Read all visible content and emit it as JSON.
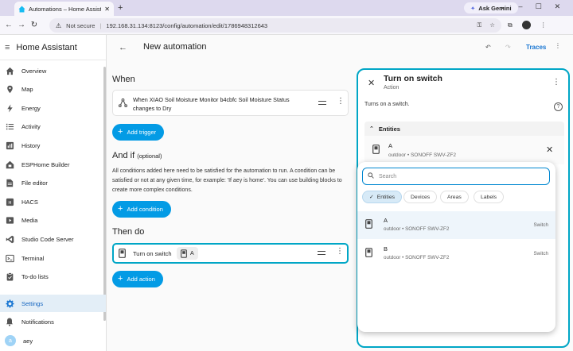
{
  "browser": {
    "tab_title": "Automations – Home Assistant",
    "new_tab": "+",
    "gemini_label": "Ask Gemini",
    "not_secure": "Not secure",
    "url": "192.168.31.134:8123/config/automation/edit/1786948312643"
  },
  "sidebar": {
    "title": "Home Assistant",
    "items": [
      {
        "label": "Overview",
        "icon": "home-icon"
      },
      {
        "label": "Map",
        "icon": "map-icon"
      },
      {
        "label": "Energy",
        "icon": "lightning-icon"
      },
      {
        "label": "Activity",
        "icon": "list-icon"
      },
      {
        "label": "History",
        "icon": "chart-icon"
      },
      {
        "label": "ESPHome Builder",
        "icon": "esphome-icon"
      },
      {
        "label": "File editor",
        "icon": "wrench-icon"
      },
      {
        "label": "HACS",
        "icon": "hacs-icon"
      },
      {
        "label": "Media",
        "icon": "media-icon"
      },
      {
        "label": "Studio Code Server",
        "icon": "vscode-icon"
      },
      {
        "label": "Terminal",
        "icon": "terminal-icon"
      },
      {
        "label": "To-do lists",
        "icon": "clipboard-icon"
      }
    ],
    "settings": "Settings",
    "notifications": "Notifications",
    "user_initial": "a",
    "user_name": "aey"
  },
  "header": {
    "title": "New automation",
    "traces": "Traces"
  },
  "when": {
    "heading": "When",
    "trigger_text": "When XIAO Soil Moisture Monitor b4cbfc Soil Moisture Status changes to Dry",
    "add_trigger": "Add trigger"
  },
  "and_if": {
    "heading": "And if",
    "optional": "(optional)",
    "description": "All conditions added here need to be satisfied for the automation to run. A condition can be satisfied or not at any given time, for example: 'If aey is home'. You can use building blocks to create more complex conditions.",
    "add_condition": "Add condition"
  },
  "then_do": {
    "heading": "Then do",
    "action_label": "Turn on switch",
    "target": "A",
    "add_action": "Add action"
  },
  "panel": {
    "title": "Turn on switch",
    "subtitle": "Action",
    "description": "Turns on a switch.",
    "entities_heading": "Entities",
    "selected": {
      "name": "A",
      "area": "outdoor",
      "device": "SONOFF SWV-ZF2"
    },
    "search_placeholder": "Search",
    "chips": [
      "Entities",
      "Devices",
      "Areas",
      "Labels"
    ],
    "options": [
      {
        "name": "A",
        "area": "outdoor",
        "device": "SONOFF SWV-ZF2",
        "domain": "Switch"
      },
      {
        "name": "B",
        "area": "outdoor",
        "device": "SONOFF SWV-ZF2",
        "domain": "Switch"
      }
    ],
    "separator": "•"
  },
  "colors": {
    "accent": "#039be5",
    "panel_border": "#00a6c6",
    "active_bg": "#e3eef7"
  }
}
